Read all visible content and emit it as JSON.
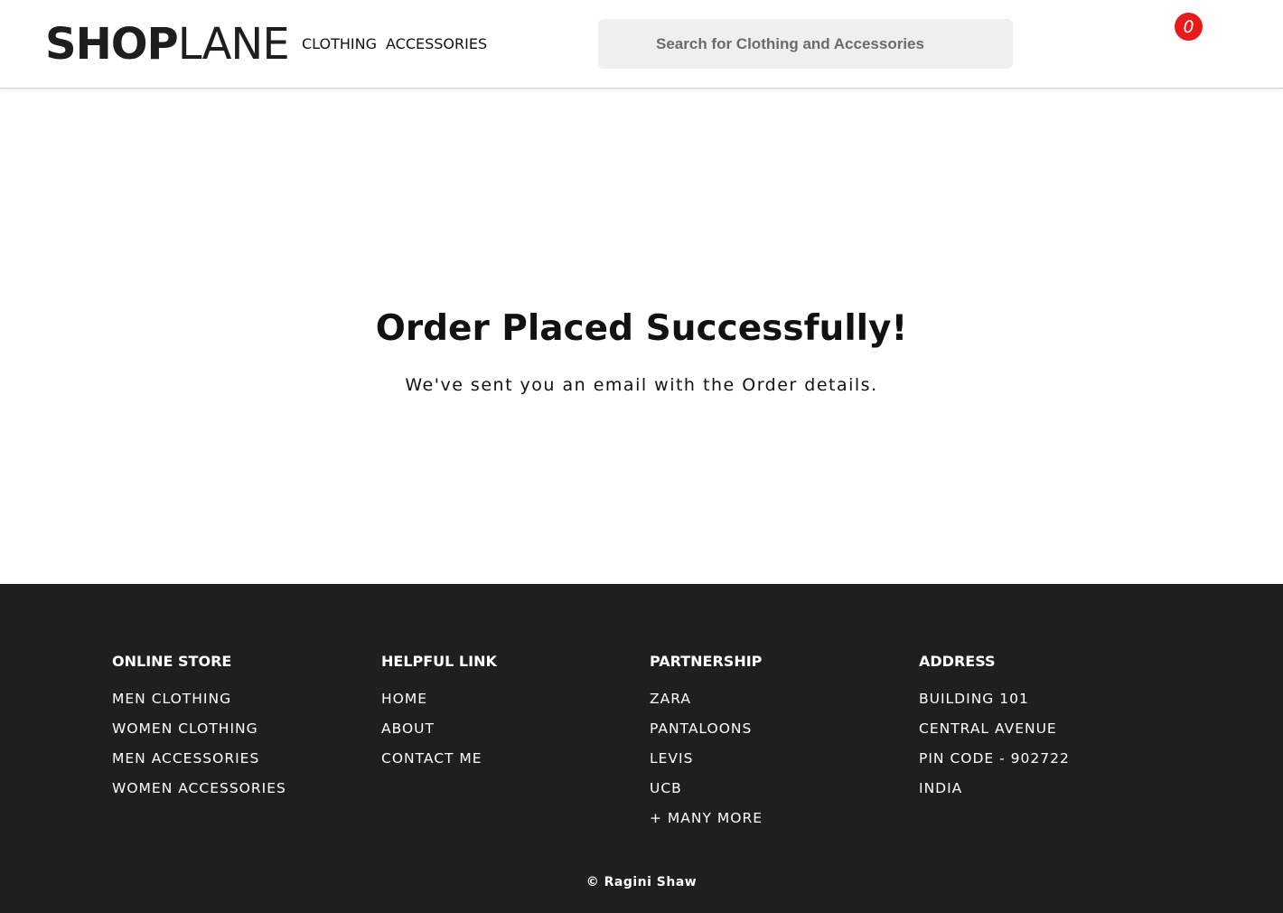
{
  "header": {
    "logo_bold": "SHOP",
    "logo_light": "LANE",
    "nav": [
      {
        "label": "CLOTHING"
      },
      {
        "label": "ACCESSORIES"
      }
    ],
    "search": {
      "placeholder": "Search for Clothing and Accessories",
      "value": ""
    },
    "cart": {
      "count": "0",
      "color": "#e41c1c",
      "icon": "cart-badge-icon"
    }
  },
  "main": {
    "title": "Order Placed Successfully!",
    "message": "We've sent you an email with the Order details."
  },
  "footer": {
    "background": "#1f1f1f",
    "columns": [
      {
        "heading": "ONLINE STORE",
        "items": [
          "MEN CLOTHING",
          "WOMEN CLOTHING",
          "MEN ACCESSORIES",
          "WOMEN ACCESSORIES"
        ]
      },
      {
        "heading": "HELPFUL LINK",
        "items": [
          "HOME",
          "ABOUT",
          "CONTACT ME"
        ]
      },
      {
        "heading": "PARTNERSHIP",
        "items": [
          "ZARA",
          "PANTALOONS",
          "LEVIS",
          "UCB",
          "+ MANY MORE"
        ]
      },
      {
        "heading": "ADDRESS",
        "items": [
          "BUILDING 101",
          "CENTRAL AVENUE",
          "PIN CODE - 902722",
          "INDIA"
        ]
      }
    ],
    "copyright": "© Ragini Shaw"
  }
}
